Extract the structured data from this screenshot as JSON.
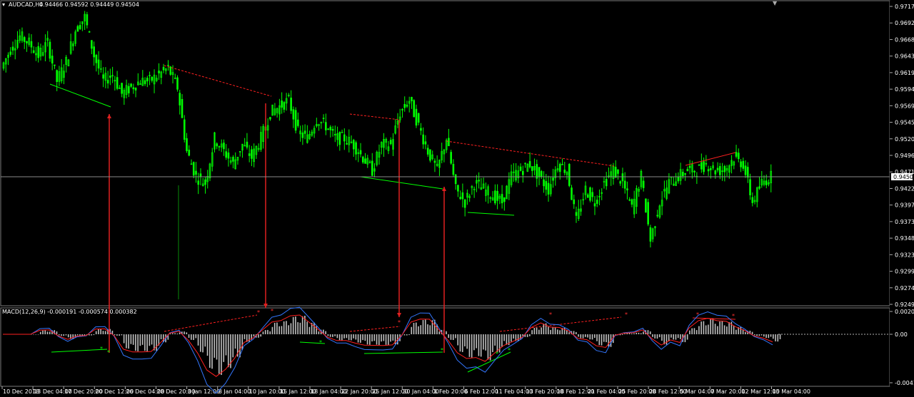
{
  "window": {
    "symbol": "AUDCAD,H4",
    "ohlc": "0.94466 0.94592 0.94449 0.94504",
    "colors": {
      "background": "#000000",
      "grid": "#5a5a5a",
      "bull": "#00ff00",
      "wick": "#00ff00",
      "macd_hist": "#c0c0c0",
      "macd_line": "#3377ff",
      "signal_line": "#ff2020",
      "arrow": "#e02020"
    }
  },
  "chart_data": [
    {
      "type": "line",
      "title": "AUDCAD,H4 0.94466 0.94592 0.94449 0.94504",
      "y_ticks": [
        "0.97170",
        "0.96925",
        "0.96680",
        "0.96435",
        "0.96190",
        "0.95945",
        "0.95695",
        "0.95450",
        "0.95205",
        "0.94960",
        "0.94710",
        "0.94220",
        "0.93975",
        "0.93730",
        "0.93480",
        "0.93235",
        "0.92990",
        "0.92745",
        "0.92495"
      ],
      "current_price": "0.94504",
      "ylim": [
        0.92495,
        0.9717
      ],
      "x_ticks": [
        "10 Dec 2018",
        "13 Dec 04:00",
        "17 Dec 20:00",
        "20 Dec 12:00",
        "26 Dec 04:00",
        "28 Dec 20:00",
        "3 Jan 12:00",
        "8 Jan 04:00",
        "10 Jan 20:00",
        "15 Jan 12:00",
        "18 Jan 04:00",
        "22 Jan 20:00",
        "25 Jan 12:00",
        "30 Jan 04:00",
        "1 Feb 20:00",
        "6 Feb 12:00",
        "11 Feb 04:00",
        "13 Feb 20:00",
        "18 Feb 12:00",
        "21 Feb 04:00",
        "25 Feb 20:00",
        "28 Feb 12:00",
        "5 Mar 04:00",
        "7 Mar 20:00",
        "12 Mar 12:00",
        "15 Mar 04:00"
      ],
      "series": [
        {
          "values": [
            0.962,
            0.965,
            0.967,
            0.966,
            0.964,
            0.966,
            0.96,
            0.963,
            0.968,
            0.97,
            0.964,
            0.96,
            0.961,
            0.958,
            0.959,
            0.96,
            0.96,
            0.961,
            0.962,
            0.959,
            0.949,
            0.945,
            0.944,
            0.951,
            0.949,
            0.947,
            0.95,
            0.948,
            0.951,
            0.955,
            0.956,
            0.957,
            0.952,
            0.951,
            0.954,
            0.953,
            0.951,
            0.951,
            0.95,
            0.948,
            0.946,
            0.95,
            0.95,
            0.955,
            0.957,
            0.953,
            0.949,
            0.946,
            0.951,
            0.943,
            0.941,
            0.944,
            0.943,
            0.942,
            0.941,
            0.945,
            0.946,
            0.947,
            0.945,
            0.943,
            0.947,
            0.946,
            0.938,
            0.943,
            0.941,
            0.944,
            0.946,
            0.944,
            0.94,
            0.945,
            0.935,
            0.941,
            0.944,
            0.945,
            0.946,
            0.946,
            0.947,
            0.946,
            0.946,
            0.948,
            0.947,
            0.941,
            0.944,
            0.945
          ]
        }
      ]
    },
    {
      "type": "bar",
      "title": "MACD(12,26,9) -0.000191 -0.000574 0.000382",
      "y_ticks": [
        "0.002085",
        "0.00",
        "-0.004136"
      ],
      "ylim": [
        -0.004136,
        0.002085
      ]
    }
  ]
}
